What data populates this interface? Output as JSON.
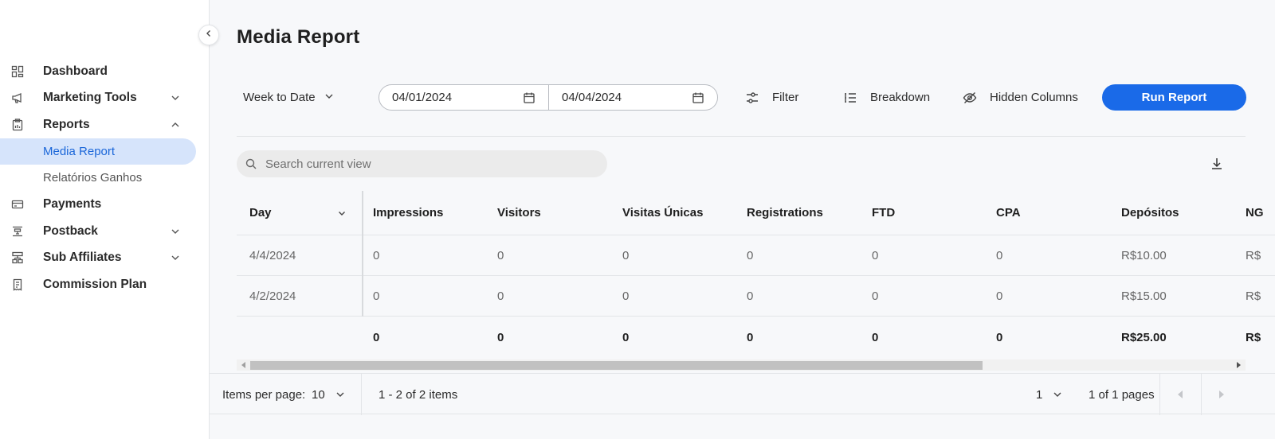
{
  "sidebar": {
    "items": [
      {
        "label": "Dashboard",
        "icon": "dashboard-icon",
        "expandable": false
      },
      {
        "label": "Marketing Tools",
        "icon": "megaphone-icon",
        "expandable": true,
        "expanded": false
      },
      {
        "label": "Reports",
        "icon": "clipboard-chart-icon",
        "expandable": true,
        "expanded": true,
        "children": [
          {
            "label": "Media Report",
            "active": true
          },
          {
            "label": "Relatórios Ganhos",
            "active": false
          }
        ]
      },
      {
        "label": "Payments",
        "icon": "credit-card-icon",
        "expandable": false
      },
      {
        "label": "Postback",
        "icon": "postback-icon",
        "expandable": true,
        "expanded": false
      },
      {
        "label": "Sub Affiliates",
        "icon": "sitemap-icon",
        "expandable": true,
        "expanded": false
      },
      {
        "label": "Commission Plan",
        "icon": "receipt-icon",
        "expandable": false
      }
    ]
  },
  "page": {
    "title": "Media Report"
  },
  "toolbar": {
    "range_label": "Week to Date",
    "date_start": "04/01/2024",
    "date_end": "04/04/2024",
    "filter_label": "Filter",
    "breakdown_label": "Breakdown",
    "hidden_columns_label": "Hidden Columns",
    "run_label": "Run Report"
  },
  "search": {
    "placeholder": "Search current view"
  },
  "table": {
    "columns": [
      "Day",
      "Impressions",
      "Visitors",
      "Visitas Únicas",
      "Registrations",
      "FTD",
      "CPA",
      "Depósitos",
      "NG"
    ],
    "rows": [
      [
        "4/4/2024",
        "0",
        "0",
        "0",
        "0",
        "0",
        "0",
        "R$10.00",
        "R$"
      ],
      [
        "4/2/2024",
        "0",
        "0",
        "0",
        "0",
        "0",
        "0",
        "R$15.00",
        "R$"
      ]
    ],
    "totals": [
      "",
      "0",
      "0",
      "0",
      "0",
      "0",
      "0",
      "R$25.00",
      "R$"
    ]
  },
  "pager": {
    "items_per_page_label": "Items per page:",
    "items_per_page": "10",
    "range_text": "1 - 2 of 2 items",
    "page": "1",
    "pages_text": "1 of 1 pages"
  },
  "colors": {
    "accent": "#1a6ae8",
    "active_bg": "#d6e4fb",
    "active_text": "#1a66d9"
  }
}
